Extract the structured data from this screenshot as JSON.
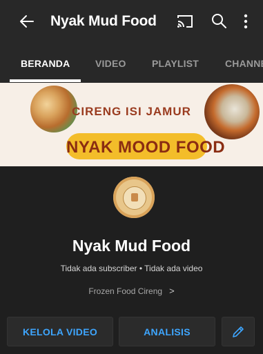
{
  "header": {
    "title": "Nyak Mud Food",
    "icons": [
      "back-arrow-icon",
      "cast-icon",
      "search-icon",
      "more-vert-icon"
    ]
  },
  "tabs": [
    {
      "label": "BERANDA",
      "active": true
    },
    {
      "label": "VIDEO",
      "active": false
    },
    {
      "label": "PLAYLIST",
      "active": false
    },
    {
      "label": "CHANNE",
      "active": false
    }
  ],
  "banner": {
    "subtitle": "CIRENG ISI JAMUR",
    "title": "NYAK MOOD FOOD"
  },
  "channel": {
    "name": "Nyak Mud Food",
    "stats": "Tidak ada subscriber • Tidak ada video",
    "description": "Frozen Food Cireng",
    "description_chevron": ">"
  },
  "actions": {
    "manage_videos": "KELOLA VIDEO",
    "analytics": "ANALISIS",
    "edit_icon": "pencil-icon"
  },
  "colors": {
    "background": "#1f1f1f",
    "bar": "#282828",
    "accent_link": "#3ea6ff",
    "banner_pill": "#f3bd2a",
    "banner_text": "#9a3b1f"
  }
}
